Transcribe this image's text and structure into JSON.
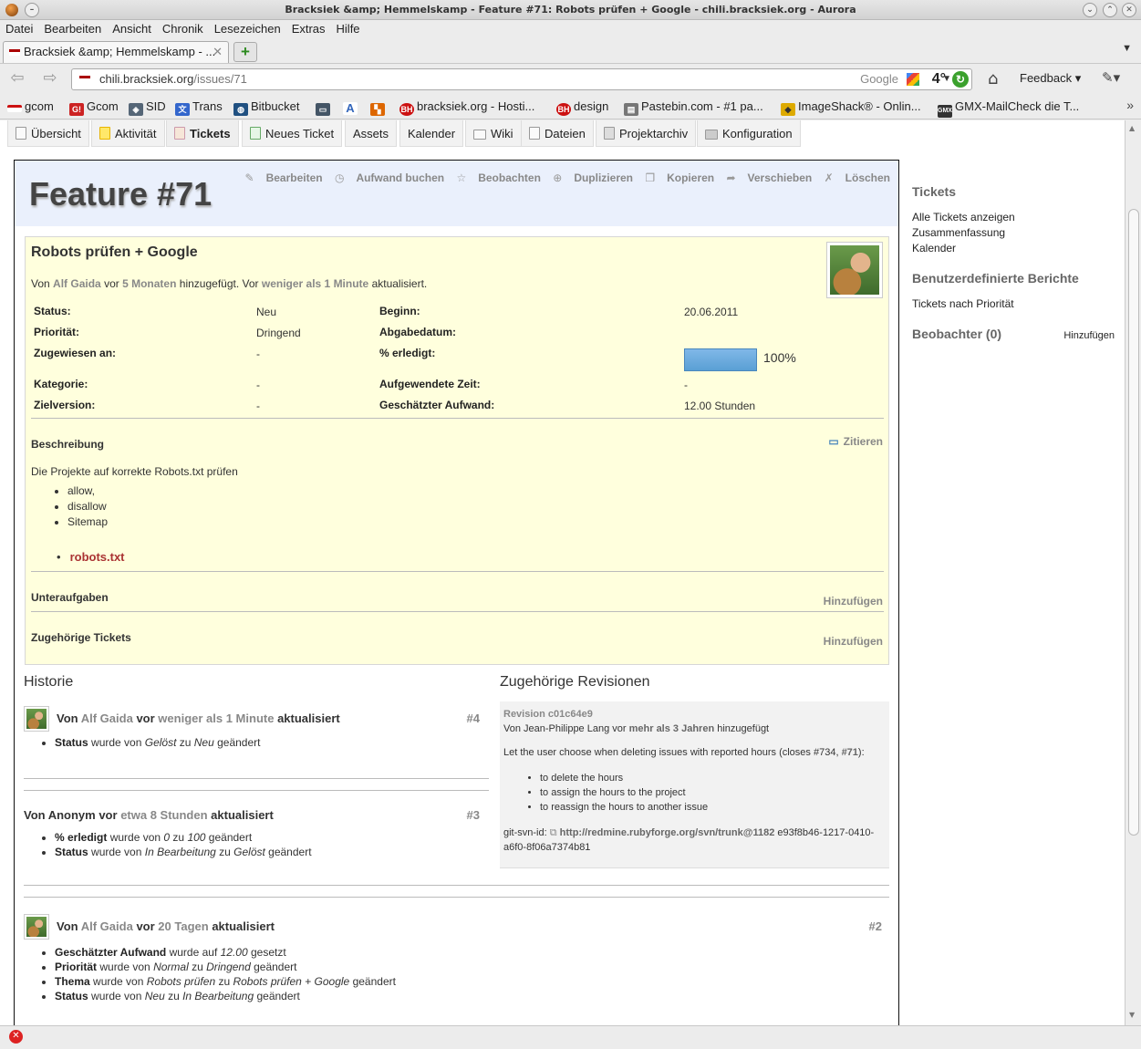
{
  "window": {
    "title": "Bracksiek &amp; Hemmelskamp - Feature #71: Robots prüfen + Google - chili.bracksiek.org - Aurora"
  },
  "menu": [
    "Datei",
    "Bearbeiten",
    "Ansicht",
    "Chronik",
    "Lesezeichen",
    "Extras",
    "Hilfe"
  ],
  "tab": {
    "label": "Bracksiek &amp; Hemmelskamp - ..."
  },
  "nav": {
    "url_host": "chili.bracksiek.org",
    "url_path": "/issues/71",
    "search_placeholder": "Google",
    "weather_temp": "4°",
    "feedback_label": "Feedback"
  },
  "bookmarks": [
    {
      "label": "gcom",
      "color": "#cc1111"
    },
    {
      "label": "Gcom",
      "color": "#cc2222"
    },
    {
      "label": "SID",
      "color": "#556677"
    },
    {
      "label": "Trans",
      "color": "#3366cc"
    },
    {
      "label": "Bitbucket",
      "color": "#205081"
    },
    {
      "label": "",
      "color": "#445566"
    },
    {
      "label": "",
      "color": "#3366bb"
    },
    {
      "label": "",
      "color": "#dd6600"
    },
    {
      "label": "bracksiek.org - Hosti...",
      "color": "#cc1111"
    },
    {
      "label": "design",
      "color": "#cc1111"
    },
    {
      "label": "Pastebin.com - #1 pa...",
      "color": "#777777"
    },
    {
      "label": "ImageShack® - Onlin...",
      "color": "#ddaa00"
    },
    {
      "label": "GMX-MailCheck die T...",
      "color": "#333333"
    }
  ],
  "project_menu": [
    "Übersicht",
    "Aktivität",
    "Tickets",
    "Neues Ticket",
    "Assets",
    "Kalender",
    "Wiki",
    "Dateien",
    "Projektarchiv",
    "Konfiguration"
  ],
  "issue": {
    "title": "Feature #71",
    "actions": [
      "Bearbeiten",
      "Aufwand buchen",
      "Beobachten",
      "Duplizieren",
      "Kopieren",
      "Verschieben",
      "Löschen"
    ],
    "subject": "Robots prüfen + Google",
    "author_prefix": "Von",
    "author": "Alf Gaida",
    "author_mid1": "vor",
    "author_age": "5 Monaten",
    "author_mid2": "hinzugefügt. Vor",
    "updated_age": "weniger als 1 Minute",
    "author_suffix": "aktualisiert.",
    "attributes": {
      "status_label": "Status:",
      "status": "Neu",
      "priority_label": "Priorität:",
      "priority": "Dringend",
      "assigned_label": "Zugewiesen an:",
      "assigned": "-",
      "category_label": "Kategorie:",
      "category": "-",
      "version_label": "Zielversion:",
      "version": "-",
      "start_label": "Beginn:",
      "start": "20.06.2011",
      "due_label": "Abgabedatum:",
      "due": "",
      "done_label": "% erledigt:",
      "done": "100%",
      "done_fraction": 1.0,
      "spent_label": "Aufgewendete Zeit:",
      "spent": "-",
      "estimated_label": "Geschätzter Aufwand:",
      "estimated": "12.00 Stunden"
    },
    "description_title": "Beschreibung",
    "quote_label": "Zitieren",
    "description_text": "Die Projekte auf korrekte Robots.txt prüfen",
    "description_items": [
      "allow,",
      "disallow",
      "Sitemap"
    ],
    "attachment": "robots.txt",
    "subtasks_title": "Unteraufgaben",
    "related_title": "Zugehörige Tickets",
    "add_label": "Hinzufügen"
  },
  "history": {
    "title": "Historie",
    "journals": [
      {
        "by": "Von",
        "author": "Alf Gaida",
        "vor": "vor",
        "age": "weniger als 1 Minute",
        "updated": "aktualisiert",
        "num": "#4",
        "details": [
          {
            "field": "Status",
            "t1": " wurde von ",
            "v1": "Gelöst",
            "t2": " zu ",
            "v2": "Neu",
            "t3": " geändert"
          }
        ]
      },
      {
        "by": "Von Anonym vor",
        "author": "",
        "vor": "",
        "age": "etwa 8 Stunden",
        "updated": "aktualisiert",
        "num": "#3",
        "details": [
          {
            "field": "% erledigt",
            "t1": " wurde von ",
            "v1": "0",
            "t2": " zu ",
            "v2": "100",
            "t3": " geändert"
          },
          {
            "field": "Status",
            "t1": " wurde von ",
            "v1": "In Bearbeitung",
            "t2": " zu ",
            "v2": "Gelöst",
            "t3": " geändert"
          }
        ]
      },
      {
        "by": "Von",
        "author": "Alf Gaida",
        "vor": "vor",
        "age": "20 Tagen",
        "updated": "aktualisiert",
        "num": "#2",
        "details": [
          {
            "field": "Geschätzter Aufwand",
            "t1": " wurde auf ",
            "v1": "12.00",
            "t2": " gesetzt",
            "v2": "",
            "t3": ""
          },
          {
            "field": "Priorität",
            "t1": " wurde von ",
            "v1": "Normal",
            "t2": " zu ",
            "v2": "Dringend",
            "t3": " geändert"
          },
          {
            "field": "Thema",
            "t1": " wurde von ",
            "v1": "Robots prüfen",
            "t2": " zu ",
            "v2": "Robots prüfen + Google",
            "t3": " geändert"
          },
          {
            "field": "Status",
            "t1": " wurde von ",
            "v1": "Neu",
            "t2": " zu ",
            "v2": "In Bearbeitung",
            "t3": " geändert"
          }
        ]
      }
    ]
  },
  "revisions": {
    "title": "Zugehörige Revisionen",
    "rev": "Revision c01c64e9",
    "by_prefix": "Von Jean-Philippe Lang vor",
    "by_age": "mehr als 3 Jahren",
    "by_suffix": "hinzugefügt",
    "message": "Let the user choose when deleting issues with reported hours (closes #734,",
    "message_link": "#71",
    "message_end": "):",
    "items": [
      "to delete the hours",
      "to assign the hours to the project",
      "to reassign the hours to another issue"
    ],
    "svn_prefix": "git-svn-id:",
    "svn_link": "http://redmine.rubyforge.org/svn/trunk@1182",
    "svn_rest": " e93f8b46-1217-0410-a6f0-8f06a7374b81"
  },
  "sidebar": {
    "tickets_title": "Tickets",
    "tickets_links": [
      "Alle Tickets anzeigen",
      "Zusammenfassung",
      "Kalender"
    ],
    "reports_title": "Benutzerdefinierte Berichte",
    "reports_links": [
      "Tickets nach Priorität"
    ],
    "watchers_title": "Beobachter (0)",
    "watchers_add": "Hinzufügen"
  }
}
